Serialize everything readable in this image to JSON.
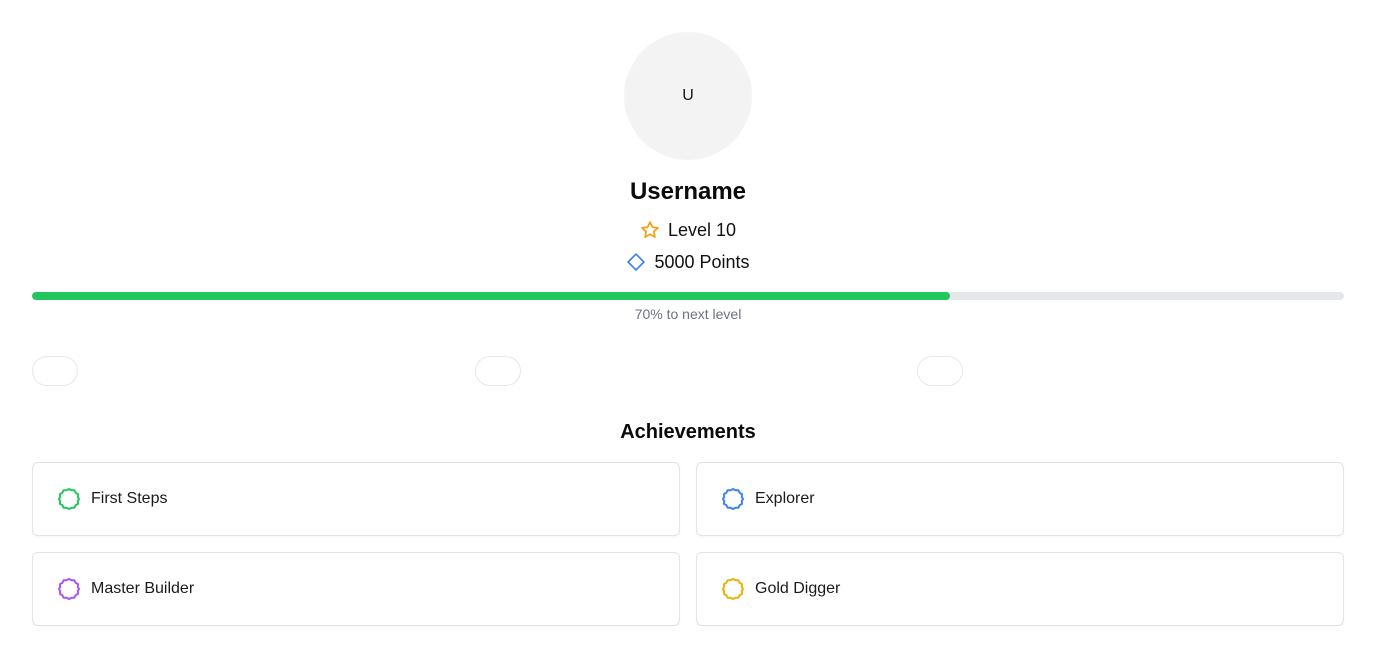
{
  "profile": {
    "avatar_initial": "U",
    "username": "Username",
    "level_label": "Level 10",
    "points_label": "5000 Points"
  },
  "progress": {
    "fraction": 0.7,
    "text": "70% to next level"
  },
  "achievements": {
    "title": "Achievements",
    "items": [
      {
        "label": "First Steps",
        "color": "#22c55e",
        "icon": "badge-icon"
      },
      {
        "label": "Explorer",
        "color": "#3b82f6",
        "icon": "badge-icon"
      },
      {
        "label": "Master Builder",
        "color": "#a855f7",
        "icon": "badge-icon"
      },
      {
        "label": "Gold Digger",
        "color": "#eab308",
        "icon": "badge-icon"
      }
    ]
  },
  "colors": {
    "level_star": "#f59e0b",
    "points_diamond": "#3b82f6",
    "progress_fill": "#22c55e",
    "progress_track": "#e5e7eb"
  }
}
